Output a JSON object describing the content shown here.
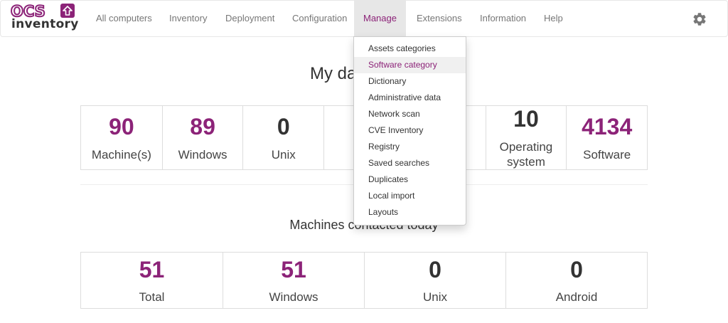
{
  "app": {
    "logo_top": "OCS",
    "logo_bottom": "inventory"
  },
  "nav": {
    "items": [
      {
        "label": "All computers"
      },
      {
        "label": "Inventory"
      },
      {
        "label": "Deployment"
      },
      {
        "label": "Configuration"
      },
      {
        "label": "Manage",
        "active": true
      },
      {
        "label": "Extensions"
      },
      {
        "label": "Information"
      },
      {
        "label": "Help"
      }
    ],
    "settings_icon": "gear-icon"
  },
  "dashboard": {
    "title": "My dashboard",
    "stats": [
      {
        "value": "90",
        "label": "Machine(s)"
      },
      {
        "value": "89",
        "label": "Windows"
      },
      {
        "value": "0",
        "label": "Unix"
      },
      {
        "value": "",
        "label": "An"
      },
      {
        "value": "",
        "label": ""
      },
      {
        "value": "10",
        "label": "Operating system"
      },
      {
        "value": "4134",
        "label": "Software"
      }
    ],
    "contacted_title": "Machines contacted today",
    "contacted": [
      {
        "value": "51",
        "label": "Total"
      },
      {
        "value": "51",
        "label": "Windows"
      },
      {
        "value": "0",
        "label": "Unix"
      },
      {
        "value": "0",
        "label": "Android"
      }
    ]
  },
  "manage_menu": {
    "items": [
      {
        "label": "Assets categories"
      },
      {
        "label": "Software category",
        "hovered": true
      },
      {
        "label": "Dictionary"
      },
      {
        "label": "Administrative data"
      },
      {
        "label": "Network scan"
      },
      {
        "label": "CVE Inventory"
      },
      {
        "label": "Registry"
      },
      {
        "label": "Saved searches"
      },
      {
        "label": "Duplicates"
      },
      {
        "label": "Local import"
      },
      {
        "label": "Layouts"
      }
    ]
  },
  "colors": {
    "accent": "#8c2378",
    "dark_number": "#333333",
    "nav_text": "#777777"
  }
}
